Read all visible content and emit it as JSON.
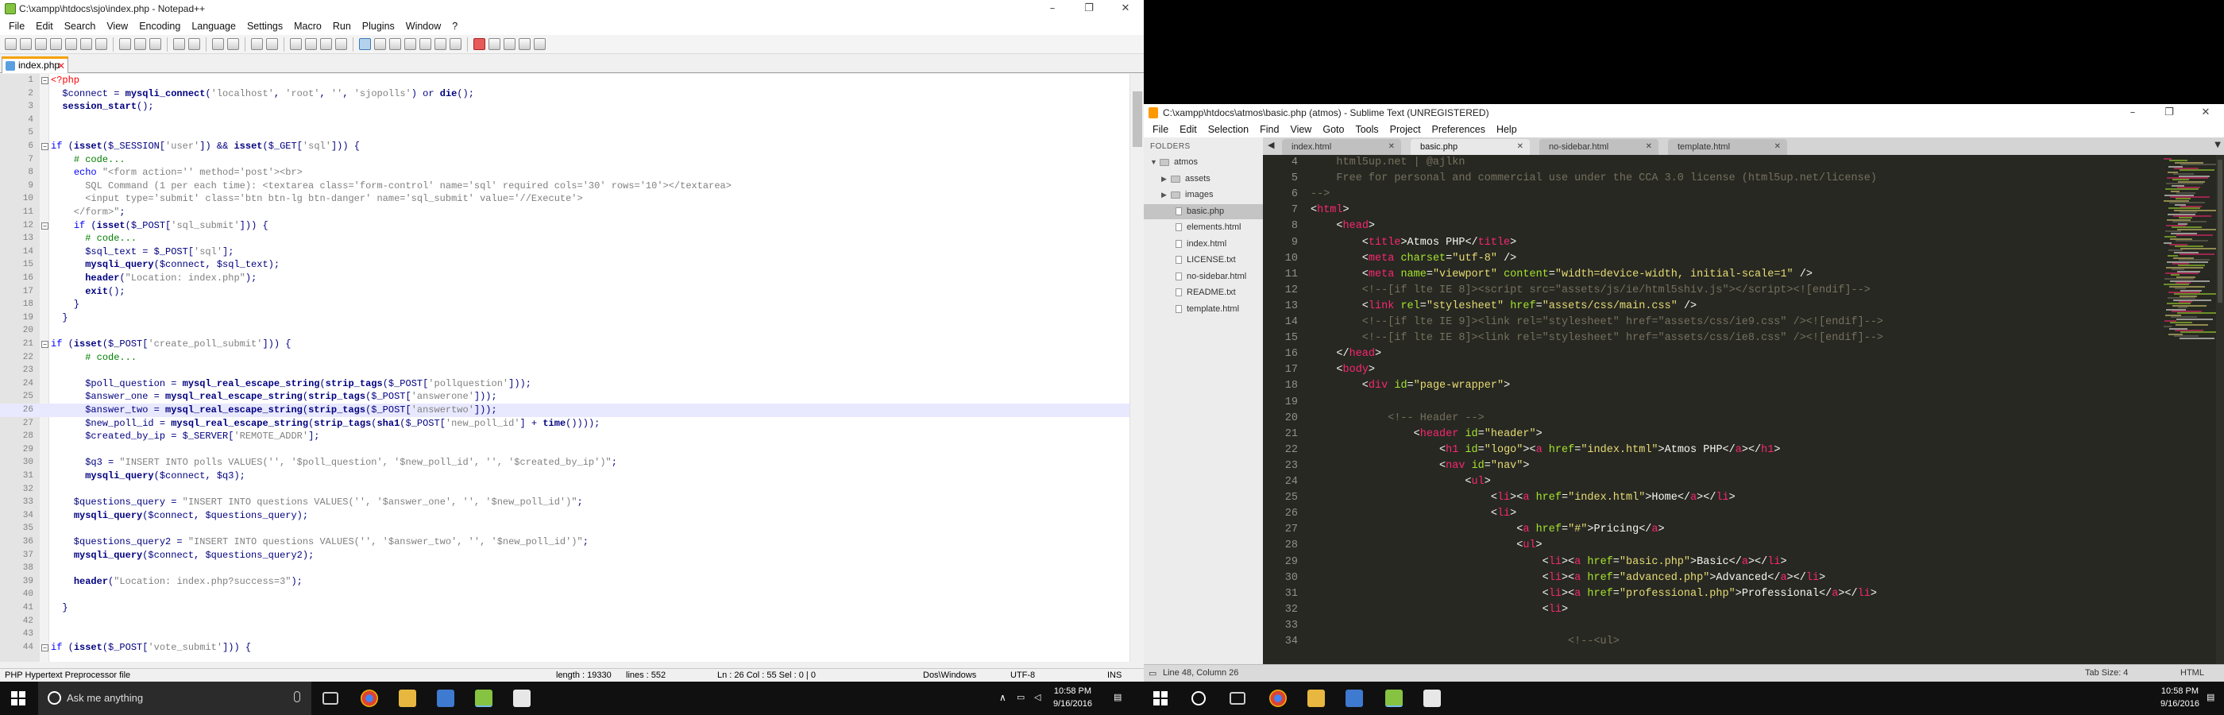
{
  "npp": {
    "title": "C:\\xampp\\htdocs\\sjo\\index.php - Notepad++",
    "menu": [
      "File",
      "Edit",
      "Search",
      "View",
      "Encoding",
      "Language",
      "Settings",
      "Macro",
      "Run",
      "Plugins",
      "Window",
      "?"
    ],
    "tab": "index.php",
    "lines": [
      {
        "n": "1",
        "h": "<span class=\"php-tag\">&lt;?php</span>",
        "fold": "-"
      },
      {
        "n": "2",
        "h": "  $connect = <b class=\"fn\">mysqli_connect</b>(<span class=\"str\">'localhost'</span>, <span class=\"str\">'root'</span>, <span class=\"str\">''</span>, <span class=\"str\">'sjopolls'</span>) or <b class=\"fn\">die</b>();"
      },
      {
        "n": "3",
        "h": "  <b class=\"fn\">session_start</b>();"
      },
      {
        "n": "4",
        "h": ""
      },
      {
        "n": "5",
        "h": ""
      },
      {
        "n": "6",
        "h": "<span class=\"kw\">if</span> (<b class=\"fn\">isset</b>($_SESSION[<span class=\"str\">'user'</span>]) &amp;&amp; <b class=\"fn\">isset</b>($_GET[<span class=\"str\">'sql'</span>])) {",
        "fold": "-"
      },
      {
        "n": "7",
        "h": "    <span class=\"cm\"># code...</span>"
      },
      {
        "n": "8",
        "h": "    <span class=\"kw\">echo</span> <span class=\"str\">\"&lt;form action='' method='post'&gt;&lt;br&gt;</span>"
      },
      {
        "n": "9",
        "h": "<span class=\"str\">      SQL Command (1 per each time): &lt;textarea class='form-control' name='sql' required cols='30' rows='10'&gt;&lt;/textarea&gt;</span>"
      },
      {
        "n": "10",
        "h": "<span class=\"str\">      &lt;input type='submit' class='btn btn-lg btn-danger' name='sql_submit' value='//Execute'&gt;</span>"
      },
      {
        "n": "11",
        "h": "<span class=\"str\">    &lt;/form&gt;\"</span>;"
      },
      {
        "n": "12",
        "h": "    <span class=\"kw\">if</span> (<b class=\"fn\">isset</b>($_POST[<span class=\"str\">'sql_submit'</span>])) {",
        "fold": "-"
      },
      {
        "n": "13",
        "h": "      <span class=\"cm\"># code...</span>"
      },
      {
        "n": "14",
        "h": "      $sql_text = $_POST[<span class=\"str\">'sql'</span>];"
      },
      {
        "n": "15",
        "h": "      <b class=\"fn\">mysqli_query</b>($connect, $sql_text);"
      },
      {
        "n": "16",
        "h": "      <b class=\"fn\">header</b>(<span class=\"str\">\"Location: index.php\"</span>);"
      },
      {
        "n": "17",
        "h": "      <b class=\"fn\">exit</b>();"
      },
      {
        "n": "18",
        "h": "    }"
      },
      {
        "n": "19",
        "h": "  }"
      },
      {
        "n": "20",
        "h": ""
      },
      {
        "n": "21",
        "h": "<span class=\"kw\">if</span> (<b class=\"fn\">isset</b>($_POST[<span class=\"str\">'create_poll_submit'</span>])) {",
        "fold": "-"
      },
      {
        "n": "22",
        "h": "      <span class=\"cm\"># code...</span>"
      },
      {
        "n": "23",
        "h": ""
      },
      {
        "n": "24",
        "h": "      $poll_question = <b class=\"fn\">mysql_real_escape_string</b>(<b class=\"fn\">strip_tags</b>($_POST[<span class=\"str\">'pollquestion'</span>]));"
      },
      {
        "n": "25",
        "h": "      $answer_one = <b class=\"fn\">mysql_real_escape_string</b>(<b class=\"fn\">strip_tags</b>($_POST[<span class=\"str\">'answerone'</span>]));"
      },
      {
        "n": "26",
        "h": "      $answer_two = <b class=\"fn\">mysql_real_escape_string</b>(<b class=\"fn\">strip_tags</b>($_POST[<span class=\"str\">'answertwo'</span>]));",
        "cur": true
      },
      {
        "n": "27",
        "h": "      $new_poll_id = <b class=\"fn\">mysql_real_escape_string</b>(<b class=\"fn\">strip_tags</b>(<b class=\"fn\">sha1</b>($_POST[<span class=\"str\">'new_poll_id'</span>] + <b class=\"fn\">time</b>())));"
      },
      {
        "n": "28",
        "h": "      $created_by_ip = $_SERVER[<span class=\"str\">'REMOTE_ADDR'</span>];"
      },
      {
        "n": "29",
        "h": ""
      },
      {
        "n": "30",
        "h": "      $q3 = <span class=\"str\">\"INSERT INTO polls VALUES('', '$poll_question', '$new_poll_id', '', '$created_by_ip')\"</span>;"
      },
      {
        "n": "31",
        "h": "      <b class=\"fn\">mysqli_query</b>($connect, $q3);"
      },
      {
        "n": "32",
        "h": ""
      },
      {
        "n": "33",
        "h": "    $questions_query = <span class=\"str\">\"INSERT INTO questions VALUES('', '$answer_one', '', '$new_poll_id')\"</span>;"
      },
      {
        "n": "34",
        "h": "    <b class=\"fn\">mysqli_query</b>($connect, $questions_query);"
      },
      {
        "n": "35",
        "h": ""
      },
      {
        "n": "36",
        "h": "    $questions_query2 = <span class=\"str\">\"INSERT INTO questions VALUES('', '$answer_two', '', '$new_poll_id')\"</span>;"
      },
      {
        "n": "37",
        "h": "    <b class=\"fn\">mysqli_query</b>($connect, $questions_query2);"
      },
      {
        "n": "38",
        "h": ""
      },
      {
        "n": "39",
        "h": "    <b class=\"fn\">header</b>(<span class=\"str\">\"Location: index.php?success=3\"</span>);"
      },
      {
        "n": "40",
        "h": ""
      },
      {
        "n": "41",
        "h": "  }"
      },
      {
        "n": "42",
        "h": ""
      },
      {
        "n": "43",
        "h": ""
      },
      {
        "n": "44",
        "h": "<span class=\"kw\">if</span> (<b class=\"fn\">isset</b>($_POST[<span class=\"str\">'vote_submit'</span>])) {",
        "fold": "-"
      }
    ],
    "status": {
      "filetype": "PHP Hypertext Preprocessor file",
      "length": "length : 19330",
      "lines": "lines : 552",
      "pos": "Ln : 26   Col : 55   Sel : 0 | 0",
      "eol": "Dos\\Windows",
      "enc": "UTF-8",
      "ins": "INS"
    }
  },
  "sublime": {
    "title": "C:\\xampp\\htdocs\\atmos\\basic.php (atmos) - Sublime Text (UNREGISTERED)",
    "menu": [
      "File",
      "Edit",
      "Selection",
      "Find",
      "View",
      "Goto",
      "Tools",
      "Project",
      "Preferences",
      "Help"
    ],
    "folders_label": "FOLDERS",
    "tree": [
      {
        "label": "atmos",
        "type": "root"
      },
      {
        "label": "assets",
        "type": "folder"
      },
      {
        "label": "images",
        "type": "folder"
      },
      {
        "label": "basic.php",
        "type": "file",
        "sel": true
      },
      {
        "label": "elements.html",
        "type": "file"
      },
      {
        "label": "index.html",
        "type": "file"
      },
      {
        "label": "LICENSE.txt",
        "type": "file"
      },
      {
        "label": "no-sidebar.html",
        "type": "file"
      },
      {
        "label": "README.txt",
        "type": "file"
      },
      {
        "label": "template.html",
        "type": "file"
      }
    ],
    "tabs": [
      {
        "label": "index.html"
      },
      {
        "label": "basic.php",
        "active": true
      },
      {
        "label": "no-sidebar.html"
      },
      {
        "label": "template.html"
      }
    ],
    "lines": [
      {
        "n": "4",
        "h": "<span class=\"m-cm\">    html5up.net | @ajlkn</span>"
      },
      {
        "n": "5",
        "h": "<span class=\"m-cm\">    Free for personal and commercial use under the CCA 3.0 license (html5up.net/license)</span>"
      },
      {
        "n": "6",
        "h": "<span class=\"m-cm\">--&gt;</span>"
      },
      {
        "n": "7",
        "h": "&lt;<span class=\"m-tag\">html</span>&gt;"
      },
      {
        "n": "8",
        "h": "    &lt;<span class=\"m-tag\">head</span>&gt;"
      },
      {
        "n": "9",
        "h": "        &lt;<span class=\"m-tag\">title</span>&gt;Atmos PHP&lt;/<span class=\"m-tag\">title</span>&gt;"
      },
      {
        "n": "10",
        "h": "        &lt;<span class=\"m-tag\">meta</span> <span class=\"m-attr\">charset</span>=<span class=\"m-str\">\"utf-8\"</span> /&gt;"
      },
      {
        "n": "11",
        "h": "        &lt;<span class=\"m-tag\">meta</span> <span class=\"m-attr\">name</span>=<span class=\"m-str\">\"viewport\"</span> <span class=\"m-attr\">content</span>=<span class=\"m-str\">\"width=device-width, initial-scale=1\"</span> /&gt;"
      },
      {
        "n": "12",
        "h": "<span class=\"m-cm\">        &lt;!--[if lte IE 8]&gt;&lt;script src=\"assets/js/ie/html5shiv.js\"&gt;&lt;/script&gt;&lt;![endif]--&gt;</span>"
      },
      {
        "n": "13",
        "h": "        &lt;<span class=\"m-tag\">link</span> <span class=\"m-attr\">rel</span>=<span class=\"m-str\">\"stylesheet\"</span> <span class=\"m-attr\">href</span>=<span class=\"m-str\">\"assets/css/main.css\"</span> /&gt;"
      },
      {
        "n": "14",
        "h": "<span class=\"m-cm\">        &lt;!--[if lte IE 9]&gt;&lt;link rel=\"stylesheet\" href=\"assets/css/ie9.css\" /&gt;&lt;![endif]--&gt;</span>"
      },
      {
        "n": "15",
        "h": "<span class=\"m-cm\">        &lt;!--[if lte IE 8]&gt;&lt;link rel=\"stylesheet\" href=\"assets/css/ie8.css\" /&gt;&lt;![endif]--&gt;</span>"
      },
      {
        "n": "16",
        "h": "    &lt;/<span class=\"m-tag\">head</span>&gt;"
      },
      {
        "n": "17",
        "h": "    &lt;<span class=\"m-tag\">body</span>&gt;"
      },
      {
        "n": "18",
        "h": "        &lt;<span class=\"m-tag\">div</span> <span class=\"m-attr\">id</span>=<span class=\"m-str\">\"page-wrapper\"</span>&gt;"
      },
      {
        "n": "19",
        "h": ""
      },
      {
        "n": "20",
        "h": "<span class=\"m-cm\">            &lt;!-- Header --&gt;</span>"
      },
      {
        "n": "21",
        "h": "                &lt;<span class=\"m-tag\">header</span> <span class=\"m-attr\">id</span>=<span class=\"m-str\">\"header\"</span>&gt;"
      },
      {
        "n": "22",
        "h": "                    &lt;<span class=\"m-tag\">h1</span> <span class=\"m-attr\">id</span>=<span class=\"m-str\">\"logo\"</span>&gt;&lt;<span class=\"m-tag\">a</span> <span class=\"m-attr\">href</span>=<span class=\"m-str\">\"index.html\"</span>&gt;Atmos PHP&lt;/<span class=\"m-tag\">a</span>&gt;&lt;/<span class=\"m-tag\">h1</span>&gt;"
      },
      {
        "n": "23",
        "h": "                    &lt;<span class=\"m-tag\">nav</span> <span class=\"m-attr\">id</span>=<span class=\"m-str\">\"nav\"</span>&gt;"
      },
      {
        "n": "24",
        "h": "                        &lt;<span class=\"m-tag\">ul</span>&gt;"
      },
      {
        "n": "25",
        "h": "                            &lt;<span class=\"m-tag\">li</span>&gt;&lt;<span class=\"m-tag\">a</span> <span class=\"m-attr\">href</span>=<span class=\"m-str\">\"index.html\"</span>&gt;Home&lt;/<span class=\"m-tag\">a</span>&gt;&lt;/<span class=\"m-tag\">li</span>&gt;"
      },
      {
        "n": "26",
        "h": "                            &lt;<span class=\"m-tag\">li</span>&gt;"
      },
      {
        "n": "27",
        "h": "                                &lt;<span class=\"m-tag\">a</span> <span class=\"m-attr\">href</span>=<span class=\"m-str\">\"#\"</span>&gt;Pricing&lt;/<span class=\"m-tag\">a</span>&gt;"
      },
      {
        "n": "28",
        "h": "                                &lt;<span class=\"m-tag\">ul</span>&gt;"
      },
      {
        "n": "29",
        "h": "                                    &lt;<span class=\"m-tag\">li</span>&gt;&lt;<span class=\"m-tag\">a</span> <span class=\"m-attr\">href</span>=<span class=\"m-str\">\"basic.php\"</span>&gt;Basic&lt;/<span class=\"m-tag\">a</span>&gt;&lt;/<span class=\"m-tag\">li</span>&gt;"
      },
      {
        "n": "30",
        "h": "                                    &lt;<span class=\"m-tag\">li</span>&gt;&lt;<span class=\"m-tag\">a</span> <span class=\"m-attr\">href</span>=<span class=\"m-str\">\"advanced.php\"</span>&gt;Advanced&lt;/<span class=\"m-tag\">a</span>&gt;&lt;/<span class=\"m-tag\">li</span>&gt;"
      },
      {
        "n": "31",
        "h": "                                    &lt;<span class=\"m-tag\">li</span>&gt;&lt;<span class=\"m-tag\">a</span> <span class=\"m-attr\">href</span>=<span class=\"m-str\">\"professional.php\"</span>&gt;Professional&lt;/<span class=\"m-tag\">a</span>&gt;&lt;/<span class=\"m-tag\">li</span>&gt;"
      },
      {
        "n": "32",
        "h": "                                    &lt;<span class=\"m-tag\">li</span>&gt;"
      },
      {
        "n": "33",
        "h": ""
      },
      {
        "n": "34",
        "h": "<span class=\"m-cm\">                                        &lt;!--&lt;ul&gt;</span>"
      }
    ],
    "status": {
      "pos": "Line 48, Column 26",
      "tabsize": "Tab Size: 4",
      "syntax": "HTML"
    }
  },
  "taskbar": {
    "search_placeholder": "Ask me anything",
    "left_time": "10:58 PM",
    "left_date": "9/16/2016",
    "right_time": "10:58 PM",
    "right_date": "9/16/2016"
  }
}
